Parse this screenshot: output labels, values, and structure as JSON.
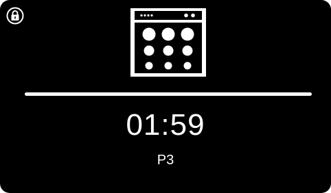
{
  "display": {
    "time": "01:59",
    "program": "P3"
  },
  "icons": {
    "lock": "lock-icon",
    "appliance": "dishwasher-icon"
  },
  "colors": {
    "background": "#000000",
    "foreground": "#ffffff"
  }
}
